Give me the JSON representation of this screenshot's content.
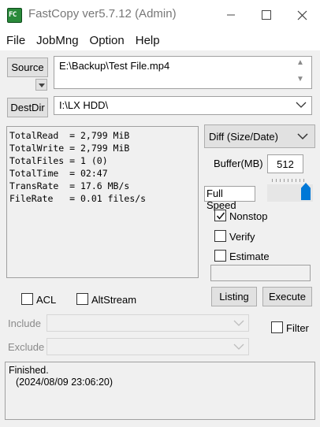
{
  "window": {
    "title": "FastCopy ver5.7.12 (Admin)",
    "icon_text": "FC"
  },
  "menu": [
    "File",
    "JobMng",
    "Option",
    "Help"
  ],
  "source": {
    "button_label": "Source",
    "path": "E:\\Backup\\Test File.mp4"
  },
  "dest": {
    "button_label": "DestDir",
    "path": "I:\\LX HDD\\"
  },
  "log": [
    "TotalRead  = 2,799 MiB",
    "TotalWrite = 2,799 MiB",
    "TotalFiles = 1 (0)",
    "TotalTime  = 02:47",
    "TransRate  = 17.6 MB/s",
    "FileRate   = 0.01 files/s"
  ],
  "mode": {
    "selected": "Diff (Size/Date)"
  },
  "buffer": {
    "label": "Buffer(MB)",
    "value": "512"
  },
  "speed": {
    "label": "Full Speed",
    "level_fraction": 1.0
  },
  "options": {
    "nonstop": {
      "label": "Nonstop",
      "checked": true
    },
    "verify": {
      "label": "Verify",
      "checked": false
    },
    "estimate": {
      "label": "Estimate",
      "checked": false
    },
    "acl": {
      "label": "ACL",
      "checked": false
    },
    "altstream": {
      "label": "AltStream",
      "checked": false
    },
    "filter": {
      "label": "Filter",
      "checked": false
    }
  },
  "actions": {
    "listing": "Listing",
    "execute": "Execute"
  },
  "filters": {
    "include_label": "Include",
    "exclude_label": "Exclude"
  },
  "status": {
    "line1": "Finished.",
    "line2": "(2024/08/09 23:06:20)"
  },
  "colors": {
    "accent": "#0078d7",
    "window_bg": "#f0f0f0"
  }
}
